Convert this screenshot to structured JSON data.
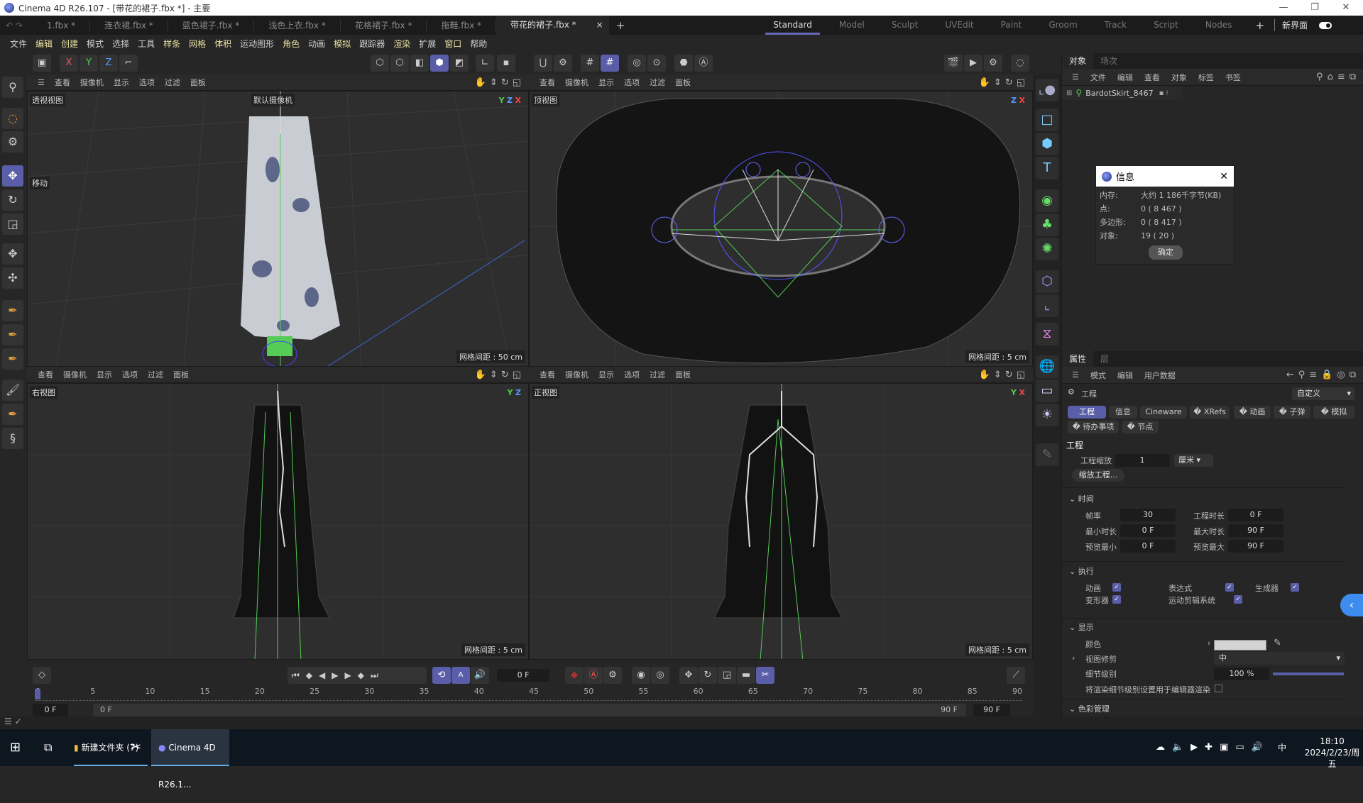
{
  "window": {
    "title": "Cinema 4D R26.107 - [带花的裙子.fbx *] - 主要",
    "minimize": "—",
    "maximize": "❐",
    "close": "✕"
  },
  "file_tabs": [
    "1.fbx *",
    "连衣裙.fbx *",
    "蓝色裙子.fbx *",
    "浅色上衣.fbx *",
    "花格裙子.fbx *",
    "拖鞋.fbx *",
    "带花的裙子.fbx *"
  ],
  "active_file_tab": 6,
  "file_tab_close": "×",
  "file_tab_add": "+",
  "layouts": [
    "Standard",
    "Model",
    "Sculpt",
    "UVEdit",
    "Paint",
    "Groom",
    "Track",
    "Script",
    "Nodes"
  ],
  "active_layout": 0,
  "layout_add": "+",
  "new_ui_label": "新界面",
  "new_ui_toggle": true,
  "menus": [
    "文件",
    "编辑",
    "创建",
    "模式",
    "选择",
    "工具",
    "样条",
    "网格",
    "体积",
    "运动图形",
    "角色",
    "动画",
    "模拟",
    "跟踪器",
    "渲染",
    "扩展",
    "窗口",
    "帮助"
  ],
  "toolbar": {
    "x": "X",
    "y": "Y",
    "z": "Z"
  },
  "viewport_menu": [
    "查看",
    "摄像机",
    "显示",
    "选项",
    "过滤",
    "面板"
  ],
  "viewports": [
    {
      "label": "透视视图",
      "grid": "网格间距 : 50 cm",
      "camera": "默认摄像机",
      "tool": "移动",
      "axes": [
        "Y",
        "Z",
        "X"
      ]
    },
    {
      "label": "顶视图",
      "grid": "网格间距 : 5 cm",
      "axes": [
        "Z",
        "X"
      ]
    },
    {
      "label": "右视图",
      "grid": "网格间距 : 5 cm",
      "axes": [
        "Y",
        "Z"
      ]
    },
    {
      "label": "正视图",
      "grid": "网格间距 : 5 cm",
      "axes": [
        "Y",
        "X"
      ]
    }
  ],
  "object_manager": {
    "tabs": [
      "对象",
      "场次"
    ],
    "menu": [
      "文件",
      "编辑",
      "查看",
      "对象",
      "标签",
      "书签"
    ],
    "object": "BardotSkirt_8467"
  },
  "info_dialog": {
    "title": "信息",
    "rows": [
      {
        "k": "内存:",
        "v": "大约 1 186千字节(KB)"
      },
      {
        "k": "点:",
        "v": "0 ( 8 467 )"
      },
      {
        "k": "多边形:",
        "v": "0 ( 8 417 )"
      },
      {
        "k": "对象:",
        "v": "19 ( 20 )"
      }
    ],
    "ok": "确定"
  },
  "attributes": {
    "tabs": [
      "属性",
      "层"
    ],
    "menu": [
      "模式",
      "编辑",
      "用户数据"
    ],
    "header": "工程",
    "preset": "自定义",
    "subtabs": [
      "工程",
      "信息",
      "Cineware",
      "XRefs",
      "动画",
      "子弹",
      "模拟",
      "待办事项",
      "节点"
    ],
    "section_title": "工程",
    "scale_label": "工程缩放",
    "scale_value": "1",
    "scale_unit": "厘米",
    "scale_button": "缩放工程...",
    "time": {
      "title": "时间",
      "fps_label": "帧率",
      "fps": "30",
      "duration_label": "工程时长",
      "duration": "0 F",
      "min_label": "最小时长",
      "min": "0 F",
      "max_label": "最大时长",
      "max": "90 F",
      "pmin_label": "预览最小",
      "pmin": "0 F",
      "pmax_label": "预览最大",
      "pmax": "90 F"
    },
    "exec": {
      "title": "执行",
      "items": [
        {
          "label": "动画",
          "checked": true
        },
        {
          "label": "表达式",
          "checked": true
        },
        {
          "label": "生成器",
          "checked": true
        },
        {
          "label": "变形器",
          "checked": true
        },
        {
          "label": "运动剪辑系统",
          "checked": true
        }
      ]
    },
    "display": {
      "title": "显示",
      "color_label": "颜色",
      "color": "#d4d4d4",
      "clip_label": "视图修剪",
      "clip": "中",
      "lod_label": "细节级别",
      "lod": "100 %",
      "lod_fraction": 1.0,
      "render_lod_label": "将渲染细节级别设置用于编辑器渲染",
      "render_lod": false
    },
    "color_mgmt": "色彩管理"
  },
  "timeline": {
    "ticks": [
      "0",
      "5",
      "10",
      "15",
      "20",
      "25",
      "30",
      "35",
      "40",
      "45",
      "50",
      "55",
      "60",
      "65",
      "70",
      "75",
      "80",
      "85",
      "90"
    ],
    "current": "0 F",
    "start": "0 F",
    "range_start": "0 F",
    "range_end": "90 F",
    "end": "90 F"
  },
  "taskbar": {
    "folder": "新建文件夹 (7)",
    "c4d": "Cinema 4D R26.1...",
    "time": "18:10",
    "date": "2024/2/23/周五",
    "ime": "中"
  },
  "colors": {
    "accent": "#5a5ea8",
    "bg": "#262626"
  }
}
